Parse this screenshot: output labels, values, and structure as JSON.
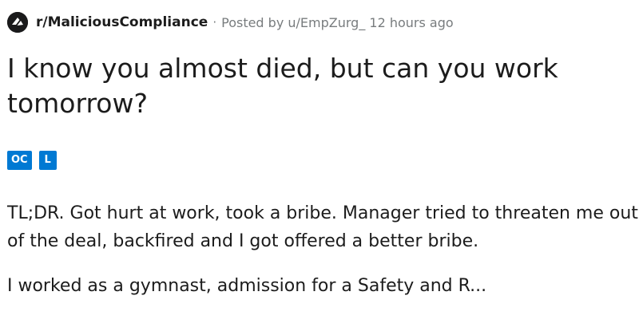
{
  "post": {
    "subreddit": "r/MaliciousCompliance",
    "separator": "·",
    "posted_by_prefix": "Posted by ",
    "author": "u/EmpZurg_",
    "time_ago": " 12 hours ago",
    "title": "I know you almost died, but can you work tomorrow?",
    "flairs": [
      "OC",
      "L"
    ],
    "body_paragraph_1": "TL;DR. Got hurt at work, took a bribe. Manager tried to threaten me out of the deal, backfired and I got offered a better bribe.",
    "body_paragraph_2_partial": "I worked as a gymnast, admission for a Safety and R..."
  },
  "icons": {
    "subreddit_icon": "subreddit-avatar-icon"
  },
  "colors": {
    "flair_background": "#0079d3",
    "meta_text": "#787c7e",
    "title_text": "#1c1c1c",
    "subreddit_icon_bg": "#1a1a1b"
  }
}
